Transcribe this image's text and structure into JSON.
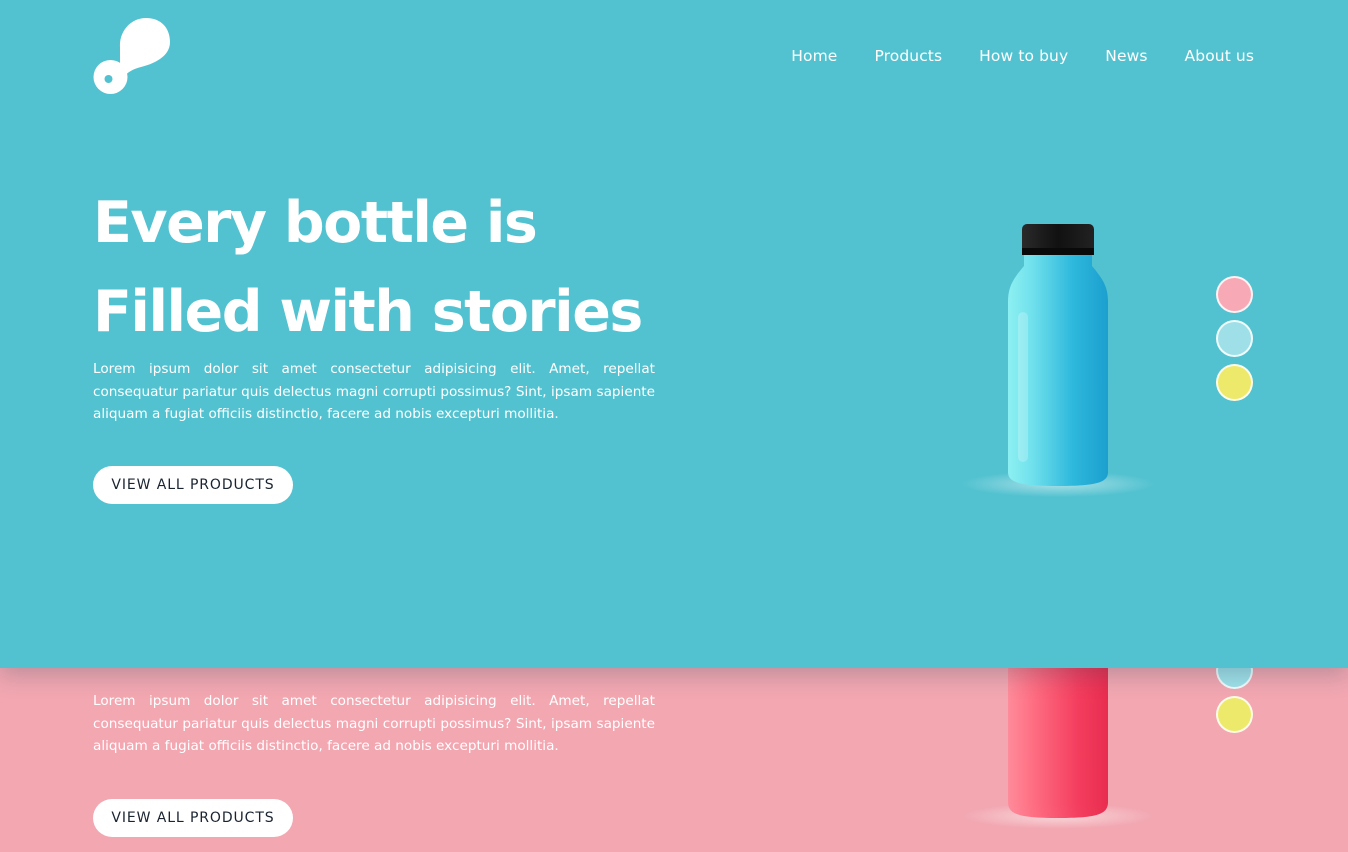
{
  "nav": {
    "items": [
      "Home",
      "Products",
      "How to buy",
      "News",
      "About us"
    ]
  },
  "hero": {
    "headline_line1": "Every bottle is",
    "headline_line2": "Filled with stories",
    "description": "Lorem ipsum dolor sit amet consectetur adipisicing elit. Amet, repellat consequatur pariatur quis delectus magni corrupti possimus? Sint, ipsam sapiente aliquam a fugiat officiis distinctio, facere ad nobis excepturi mollitia.",
    "cta_label": "VIEW ALL PRODUCTS"
  },
  "next_section": {
    "description": "Lorem ipsum dolor sit amet consectetur adipisicing elit. Amet, repellat consequatur pariatur quis delectus magni corrupti possimus? Sint, ipsam sapiente aliquam a fugiat officiis distinctio, facere ad nobis excepturi mollitia.",
    "cta_label": "VIEW ALL PRODUCTS"
  },
  "colors": {
    "blue_bg": "#53c2d0",
    "pink_bg": "#f2a7b1",
    "swatch_pink": "#f7a9b5",
    "swatch_blue": "#9fe0e8",
    "swatch_yellow": "#ede96a",
    "bottle_blue": "#2bb6db",
    "bottle_red": "#f0405f"
  },
  "icons": {
    "logo": "drop-logo-icon",
    "bottle": "product-bottle-icon"
  }
}
